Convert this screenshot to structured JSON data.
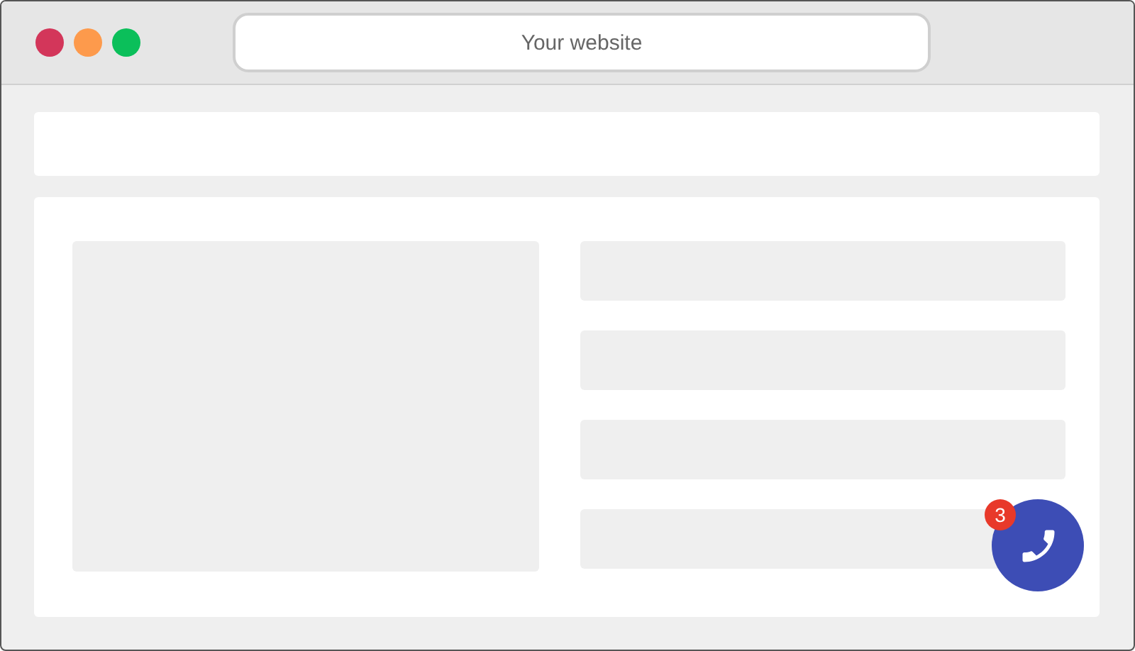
{
  "window": {
    "controls": [
      {
        "color": "#d3365a"
      },
      {
        "color": "#fd9a4c"
      },
      {
        "color": "#0bbf5a"
      }
    ],
    "address": "Your website"
  },
  "call_button": {
    "badge": "3"
  }
}
